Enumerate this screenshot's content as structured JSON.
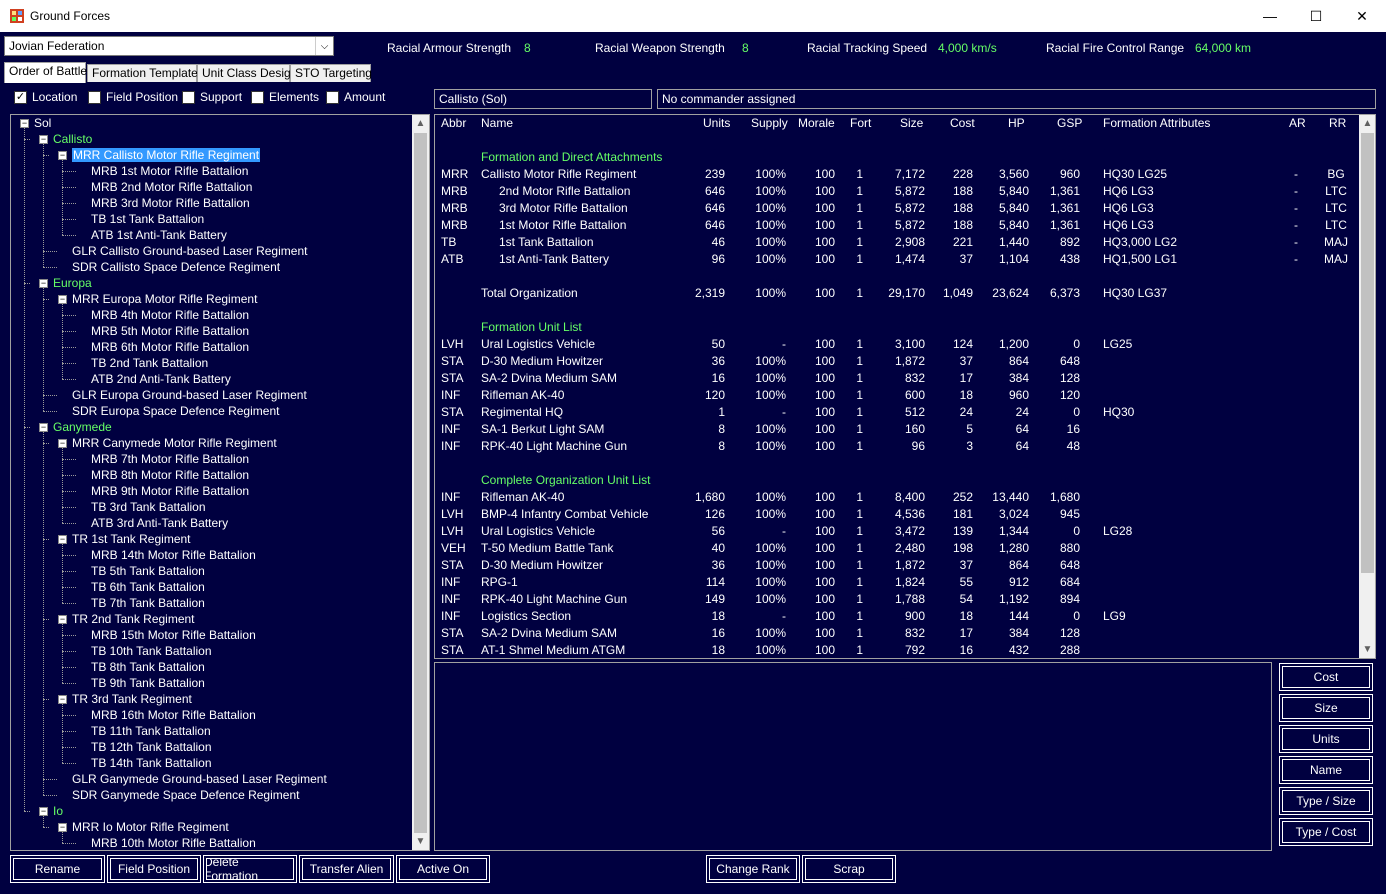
{
  "window": {
    "title": "Ground Forces",
    "minimize": "—",
    "maximize": "☐",
    "close": "✕"
  },
  "nation": {
    "selected": "Jovian Federation"
  },
  "stats": [
    {
      "label": "Racial Armour Strength",
      "value": "8"
    },
    {
      "label": "Racial Weapon Strength",
      "value": "8"
    },
    {
      "label": "Racial Tracking Speed",
      "value": "4,000 km/s"
    },
    {
      "label": "Racial Fire Control Range",
      "value": "64,000 km"
    }
  ],
  "tabs": [
    "Order of Battle",
    "Formation Templates",
    "Unit Class Design",
    "STO Targeting"
  ],
  "filters": [
    {
      "label": "Location",
      "checked": true
    },
    {
      "label": "Field Position",
      "checked": false
    },
    {
      "label": "Support",
      "checked": false
    },
    {
      "label": "Elements",
      "checked": false
    },
    {
      "label": "Amount",
      "checked": false
    }
  ],
  "location_display": "Callisto  (Sol)",
  "commander_display": "No commander assigned",
  "tree": [
    {
      "label": "Sol",
      "level": 0,
      "expander": true
    },
    {
      "label": "Callisto",
      "level": 1,
      "expander": true,
      "green": true
    },
    {
      "label": "MRR Callisto Motor Rifle Regiment",
      "level": 2,
      "expander": true,
      "selected": true
    },
    {
      "label": "MRB 1st Motor Rifle Battalion",
      "level": 3
    },
    {
      "label": "MRB 2nd Motor Rifle Battalion",
      "level": 3
    },
    {
      "label": "MRB 3rd Motor Rifle Battalion",
      "level": 3
    },
    {
      "label": "TB 1st Tank Battalion",
      "level": 3
    },
    {
      "label": "ATB 1st Anti-Tank Battery",
      "level": 3
    },
    {
      "label": "GLR Callisto Ground-based Laser Regiment",
      "level": 2
    },
    {
      "label": "SDR Callisto Space Defence Regiment",
      "level": 2
    },
    {
      "label": "Europa",
      "level": 1,
      "expander": true,
      "green": true
    },
    {
      "label": "MRR Europa Motor Rifle Regiment",
      "level": 2,
      "expander": true
    },
    {
      "label": "MRB 4th Motor Rifle Battalion",
      "level": 3
    },
    {
      "label": "MRB 5th Motor Rifle Battalion",
      "level": 3
    },
    {
      "label": "MRB 6th Motor Rifle Battalion",
      "level": 3
    },
    {
      "label": "TB 2nd Tank Battalion",
      "level": 3
    },
    {
      "label": "ATB 2nd Anti-Tank Battery",
      "level": 3
    },
    {
      "label": "GLR Europa Ground-based Laser Regiment",
      "level": 2
    },
    {
      "label": "SDR Europa Space Defence Regiment",
      "level": 2
    },
    {
      "label": "Ganymede",
      "level": 1,
      "expander": true,
      "green": true
    },
    {
      "label": "MRR Canymede Motor Rifle Regiment",
      "level": 2,
      "expander": true
    },
    {
      "label": "MRB 7th Motor Rifle Battalion",
      "level": 3
    },
    {
      "label": "MRB 8th Motor Rifle Battalion",
      "level": 3
    },
    {
      "label": "MRB 9th Motor Rifle Battalion",
      "level": 3
    },
    {
      "label": "TB 3rd Tank Battalion",
      "level": 3
    },
    {
      "label": "ATB 3rd Anti-Tank Battery",
      "level": 3
    },
    {
      "label": "TR 1st Tank Regiment",
      "level": 2,
      "expander": true
    },
    {
      "label": "MRB 14th Motor Rifle Battalion",
      "level": 3
    },
    {
      "label": "TB 5th Tank Battalion",
      "level": 3
    },
    {
      "label": "TB 6th Tank Battalion",
      "level": 3
    },
    {
      "label": "TB 7th Tank Battalion",
      "level": 3
    },
    {
      "label": "TR 2nd Tank Regiment",
      "level": 2,
      "expander": true
    },
    {
      "label": "MRB 15th Motor Rifle Battalion",
      "level": 3
    },
    {
      "label": "TB 10th Tank Battalion",
      "level": 3
    },
    {
      "label": "TB 8th Tank Battalion",
      "level": 3
    },
    {
      "label": "TB 9th Tank Battalion",
      "level": 3
    },
    {
      "label": "TR 3rd Tank Regiment",
      "level": 2,
      "expander": true
    },
    {
      "label": "MRB 16th Motor Rifle Battalion",
      "level": 3
    },
    {
      "label": "TB 11th Tank Battalion",
      "level": 3
    },
    {
      "label": "TB 12th Tank Battalion",
      "level": 3
    },
    {
      "label": "TB 14th Tank Battalion",
      "level": 3
    },
    {
      "label": "GLR Ganymede Ground-based Laser Regiment",
      "level": 2
    },
    {
      "label": "SDR Ganymede Space Defence Regiment",
      "level": 2
    },
    {
      "label": "Io",
      "level": 1,
      "expander": true,
      "green": true
    },
    {
      "label": "MRR Io Motor Rifle Regiment",
      "level": 2,
      "expander": true
    },
    {
      "label": "MRB 10th Motor Rifle Battalion",
      "level": 3
    }
  ],
  "grid": {
    "columns": [
      "Abbr",
      "Name",
      "Units",
      "Supply",
      "Morale",
      "Fort",
      "Size",
      "Cost",
      "HP",
      "GSP",
      "Formation Attributes",
      "AR",
      "RR"
    ],
    "sections": [
      {
        "title": "Formation and Direct Attachments",
        "rows": [
          {
            "abbr": "MRR",
            "name": "Callisto Motor Rifle Regiment",
            "indent": false,
            "units": "239",
            "supply": "100%",
            "morale": "100",
            "fort": "1",
            "size": "7,172",
            "cost": "228",
            "hp": "3,560",
            "gsp": "960",
            "attr": "HQ30  LG25",
            "ar": "-",
            "rr": "BG"
          },
          {
            "abbr": "MRB",
            "name": "2nd Motor Rifle Battalion",
            "indent": true,
            "units": "646",
            "supply": "100%",
            "morale": "100",
            "fort": "1",
            "size": "5,872",
            "cost": "188",
            "hp": "5,840",
            "gsp": "1,361",
            "attr": "HQ6  LG3",
            "ar": "-",
            "rr": "LTC"
          },
          {
            "abbr": "MRB",
            "name": "3rd Motor Rifle Battalion",
            "indent": true,
            "units": "646",
            "supply": "100%",
            "morale": "100",
            "fort": "1",
            "size": "5,872",
            "cost": "188",
            "hp": "5,840",
            "gsp": "1,361",
            "attr": "HQ6  LG3",
            "ar": "-",
            "rr": "LTC"
          },
          {
            "abbr": "MRB",
            "name": "1st Motor Rifle Battalion",
            "indent": true,
            "units": "646",
            "supply": "100%",
            "morale": "100",
            "fort": "1",
            "size": "5,872",
            "cost": "188",
            "hp": "5,840",
            "gsp": "1,361",
            "attr": "HQ6  LG3",
            "ar": "-",
            "rr": "LTC"
          },
          {
            "abbr": "TB",
            "name": "1st Tank Battalion",
            "indent": true,
            "units": "46",
            "supply": "100%",
            "morale": "100",
            "fort": "1",
            "size": "2,908",
            "cost": "221",
            "hp": "1,440",
            "gsp": "892",
            "attr": "HQ3,000  LG2",
            "ar": "-",
            "rr": "MAJ"
          },
          {
            "abbr": "ATB",
            "name": "1st Anti-Tank Battery",
            "indent": true,
            "units": "96",
            "supply": "100%",
            "morale": "100",
            "fort": "1",
            "size": "1,474",
            "cost": "37",
            "hp": "1,104",
            "gsp": "438",
            "attr": "HQ1,500  LG1",
            "ar": "-",
            "rr": "MAJ"
          }
        ],
        "total": {
          "name": "Total Organization",
          "units": "2,319",
          "supply": "100%",
          "morale": "100",
          "fort": "1",
          "size": "29,170",
          "cost": "1,049",
          "hp": "23,624",
          "gsp": "6,373",
          "attr": "HQ30  LG37"
        }
      },
      {
        "title": "Formation Unit List",
        "rows": [
          {
            "abbr": "LVH",
            "name": "Ural Logistics Vehicle",
            "units": "50",
            "supply": "-",
            "morale": "100",
            "fort": "1",
            "size": "3,100",
            "cost": "124",
            "hp": "1,200",
            "gsp": "0",
            "attr": "LG25"
          },
          {
            "abbr": "STA",
            "name": "D-30 Medium Howitzer",
            "units": "36",
            "supply": "100%",
            "morale": "100",
            "fort": "1",
            "size": "1,872",
            "cost": "37",
            "hp": "864",
            "gsp": "648",
            "attr": ""
          },
          {
            "abbr": "STA",
            "name": "SA-2 Dvina Medium SAM",
            "units": "16",
            "supply": "100%",
            "morale": "100",
            "fort": "1",
            "size": "832",
            "cost": "17",
            "hp": "384",
            "gsp": "128",
            "attr": ""
          },
          {
            "abbr": "INF",
            "name": "Rifleman AK-40",
            "units": "120",
            "supply": "100%",
            "morale": "100",
            "fort": "1",
            "size": "600",
            "cost": "18",
            "hp": "960",
            "gsp": "120",
            "attr": ""
          },
          {
            "abbr": "STA",
            "name": "Regimental HQ",
            "units": "1",
            "supply": "-",
            "morale": "100",
            "fort": "1",
            "size": "512",
            "cost": "24",
            "hp": "24",
            "gsp": "0",
            "attr": "HQ30"
          },
          {
            "abbr": "INF",
            "name": "SA-1 Berkut Light SAM",
            "units": "8",
            "supply": "100%",
            "morale": "100",
            "fort": "1",
            "size": "160",
            "cost": "5",
            "hp": "64",
            "gsp": "16",
            "attr": ""
          },
          {
            "abbr": "INF",
            "name": "RPK-40 Light Machine Gun",
            "units": "8",
            "supply": "100%",
            "morale": "100",
            "fort": "1",
            "size": "96",
            "cost": "3",
            "hp": "64",
            "gsp": "48",
            "attr": ""
          }
        ]
      },
      {
        "title": "Complete Organization Unit List",
        "rows": [
          {
            "abbr": "INF",
            "name": "Rifleman AK-40",
            "units": "1,680",
            "supply": "100%",
            "morale": "100",
            "fort": "1",
            "size": "8,400",
            "cost": "252",
            "hp": "13,440",
            "gsp": "1,680",
            "attr": ""
          },
          {
            "abbr": "LVH",
            "name": "BMP-4 Infantry Combat Vehicle",
            "units": "126",
            "supply": "100%",
            "morale": "100",
            "fort": "1",
            "size": "4,536",
            "cost": "181",
            "hp": "3,024",
            "gsp": "945",
            "attr": ""
          },
          {
            "abbr": "LVH",
            "name": "Ural Logistics Vehicle",
            "units": "56",
            "supply": "-",
            "morale": "100",
            "fort": "1",
            "size": "3,472",
            "cost": "139",
            "hp": "1,344",
            "gsp": "0",
            "attr": "LG28"
          },
          {
            "abbr": "VEH",
            "name": "T-50 Medium Battle Tank",
            "units": "40",
            "supply": "100%",
            "morale": "100",
            "fort": "1",
            "size": "2,480",
            "cost": "198",
            "hp": "1,280",
            "gsp": "880",
            "attr": ""
          },
          {
            "abbr": "STA",
            "name": "D-30 Medium Howitzer",
            "units": "36",
            "supply": "100%",
            "morale": "100",
            "fort": "1",
            "size": "1,872",
            "cost": "37",
            "hp": "864",
            "gsp": "648",
            "attr": ""
          },
          {
            "abbr": "INF",
            "name": "RPG-1",
            "units": "114",
            "supply": "100%",
            "morale": "100",
            "fort": "1",
            "size": "1,824",
            "cost": "55",
            "hp": "912",
            "gsp": "684",
            "attr": ""
          },
          {
            "abbr": "INF",
            "name": "RPK-40 Light Machine Gun",
            "units": "149",
            "supply": "100%",
            "morale": "100",
            "fort": "1",
            "size": "1,788",
            "cost": "54",
            "hp": "1,192",
            "gsp": "894",
            "attr": ""
          },
          {
            "abbr": "INF",
            "name": "Logistics Section",
            "units": "18",
            "supply": "-",
            "morale": "100",
            "fort": "1",
            "size": "900",
            "cost": "18",
            "hp": "144",
            "gsp": "0",
            "attr": "LG9"
          },
          {
            "abbr": "STA",
            "name": "SA-2 Dvina Medium SAM",
            "units": "16",
            "supply": "100%",
            "morale": "100",
            "fort": "1",
            "size": "832",
            "cost": "17",
            "hp": "384",
            "gsp": "128",
            "attr": ""
          },
          {
            "abbr": "STA",
            "name": "AT-1 Shmel Medium ATGM",
            "units": "18",
            "supply": "100%",
            "morale": "100",
            "fort": "1",
            "size": "792",
            "cost": "16",
            "hp": "432",
            "gsp": "288",
            "attr": ""
          }
        ]
      }
    ]
  },
  "sort_buttons": [
    "Cost",
    "Size",
    "Units",
    "Name",
    "Type / Size",
    "Type / Cost"
  ],
  "bottom_buttons": [
    "Rename",
    "Field Position",
    "Delete Formation",
    "Transfer Alien",
    "Active On"
  ],
  "center_buttons": [
    "Change Rank",
    "Scrap"
  ],
  "scroll_arrows": {
    "up": "▲",
    "down": "▼"
  },
  "dropdown_arrow": "⌵",
  "checkmark": "✓",
  "tree_expander": "−"
}
